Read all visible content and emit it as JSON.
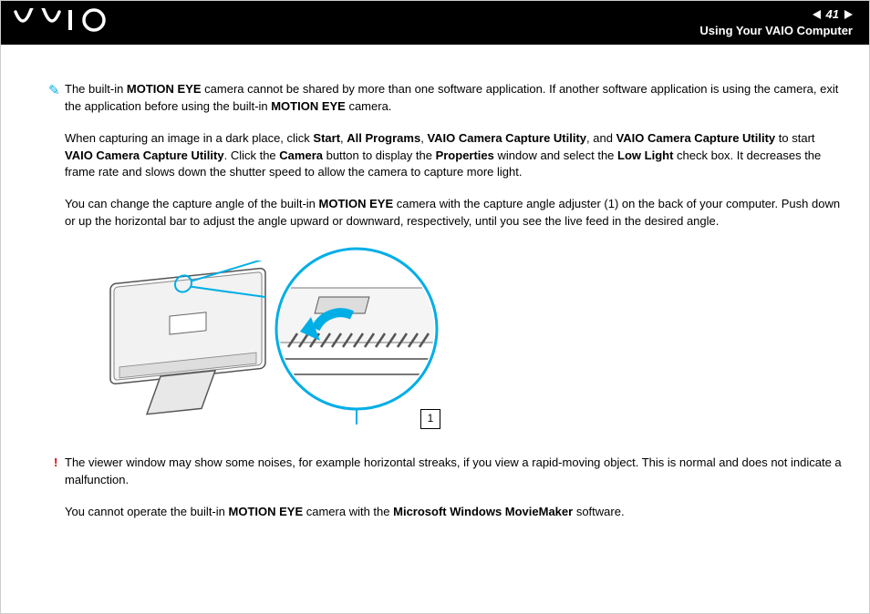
{
  "header": {
    "logo_text": "VAIO",
    "page_number": "41",
    "section": "Using Your VAIO Computer"
  },
  "body": {
    "note1_pre": "The built-in ",
    "note1_b1": "MOTION EYE",
    "note1_mid": " camera cannot be shared by more than one software application. If another software application is using the camera, exit the application before using the built-in ",
    "note1_b2": "MOTION EYE",
    "note1_post": " camera.",
    "p2_a": "When capturing an image in a dark place, click ",
    "p2_b1": "Start",
    "p2_c": ", ",
    "p2_b2": "All Programs",
    "p2_d": ", ",
    "p2_b3": "VAIO Camera Capture Utility",
    "p2_e": ", and ",
    "p2_b4": "VAIO Camera Capture Utility",
    "p2_f": " to start ",
    "p2_b5": "VAIO Camera Capture Utility",
    "p2_g": ". Click the ",
    "p2_b6": "Camera",
    "p2_h": " button to display the ",
    "p2_b7": "Properties",
    "p2_i": " window and select the ",
    "p2_b8": "Low Light",
    "p2_j": " check box. It decreases the frame rate and slows down the shutter speed to allow the camera to capture more light.",
    "p3_a": "You can change the capture angle of the built-in ",
    "p3_b1": "MOTION EYE",
    "p3_b": " camera with the capture angle adjuster (1) on the back of your computer. Push down or up the horizontal bar to adjust the angle upward or downward, respectively, until you see the live feed in the desired angle.",
    "warn_a": "The viewer window may show some noises, for example horizontal streaks, if you view a rapid-moving object. This is normal and does not indicate a malfunction.",
    "p5_a": "You cannot operate the built-in ",
    "p5_b1": "MOTION EYE",
    "p5_b": " camera with the ",
    "p5_b2": "Microsoft Windows MovieMaker",
    "p5_c": " software.",
    "figure_label": "1"
  }
}
